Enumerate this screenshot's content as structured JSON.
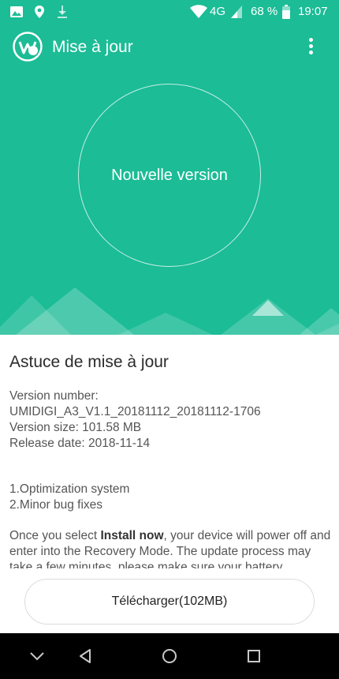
{
  "status_bar": {
    "network": "4G",
    "battery": "68 %",
    "time": "19:07"
  },
  "header": {
    "title": "Mise à jour"
  },
  "hero": {
    "circle_label": "Nouvelle version"
  },
  "content": {
    "tip_title": "Astuce de mise à jour",
    "info": {
      "version_number_label": "Version number:",
      "version_number": "UMIDIGI_A3_V1.1_20181112_20181112-1706",
      "version_size": "Version size: 101.58 MB",
      "release_date": "Release date: 2018-11-14"
    },
    "notes": [
      "1.Optimization system",
      "2.Minor bug fixes"
    ],
    "description": {
      "prefix": "Once you select ",
      "bold": "Install now",
      "suffix": ", your device will power off and enter into the Recovery Mode. The update process may take a few minutes, please make sure your battery"
    }
  },
  "download_button": {
    "label": "Télécharger(102MB)"
  },
  "colors": {
    "brand": "#1bbc96",
    "nav_bar": "#000000"
  },
  "icons": {
    "status_left": [
      "image-icon",
      "location-icon",
      "download-icon"
    ],
    "status_right": [
      "wifi-icon",
      "signal-icon",
      "battery-icon"
    ],
    "nav": [
      "collapse-icon",
      "back-icon",
      "home-icon",
      "recents-icon"
    ]
  }
}
